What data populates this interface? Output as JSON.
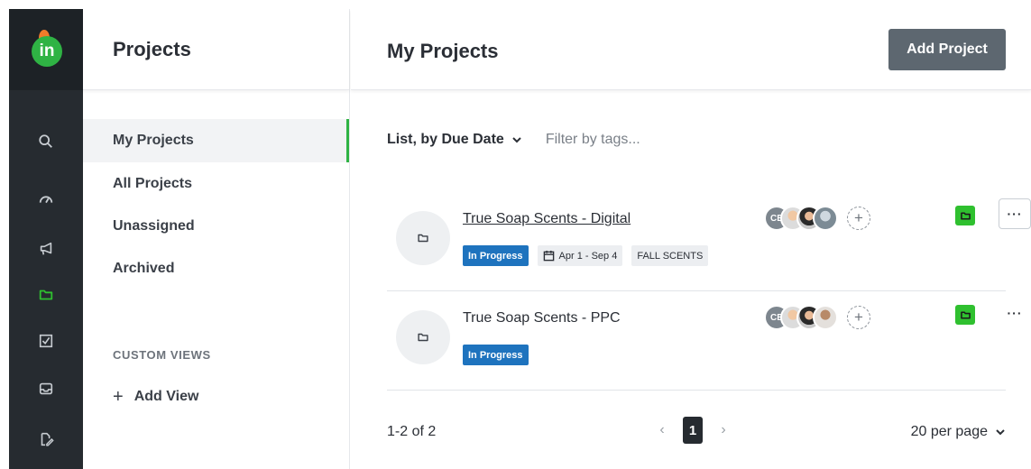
{
  "sidebar": {
    "title": "Projects",
    "items": [
      {
        "label": "My Projects"
      },
      {
        "label": "All Projects"
      },
      {
        "label": "Unassigned"
      },
      {
        "label": "Archived"
      }
    ],
    "section_label": "CUSTOM VIEWS",
    "add_view_label": "Add View"
  },
  "rail": {
    "icons": [
      "search-icon",
      "dashboard-icon",
      "megaphone-icon",
      "folder-icon",
      "checkbox-icon",
      "inbox-icon",
      "file-edit-icon"
    ],
    "active_icon": "folder-icon"
  },
  "main": {
    "title": "My Projects",
    "add_project_label": "Add Project",
    "view_select": "List, by Due Date",
    "filter_placeholder": "Filter by tags...",
    "projects": [
      {
        "name": "True Soap Scents - Digital",
        "status": "In Progress",
        "date_range": "Apr 1 - Sep 4",
        "tag": "FALL SCENTS",
        "members_initials": "CE"
      },
      {
        "name": "True Soap Scents - PPC",
        "status": "In Progress",
        "members_initials": "CE"
      }
    ],
    "pagination": {
      "count_text": "1-2 of 2",
      "current_page": "1",
      "per_page": "20 per page"
    }
  },
  "colors": {
    "accent_green": "#2fb344",
    "status_blue": "#1e73be",
    "rail_bg": "#262b30",
    "button_gray": "#5d6770"
  }
}
